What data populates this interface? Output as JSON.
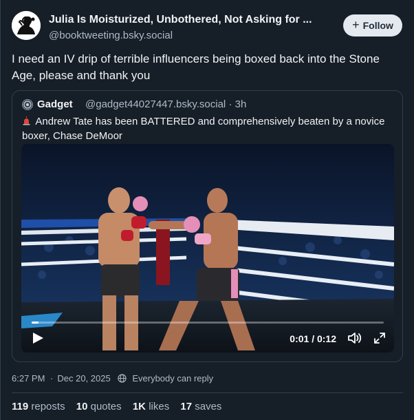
{
  "author": {
    "name": "Julia Is Moisturized, Unbothered, Not Asking for ...",
    "handle": "@booktweeting.bsky.social"
  },
  "follow_label": "Follow",
  "post_text": "I need an IV drip of terrible influencers being boxed back into the Stone Age, please and thank you",
  "quote": {
    "name": "Gadget",
    "handle": "@gadget44027447.bsky.social",
    "separator": "·",
    "age": "3h",
    "text": "Andrew Tate has been BATTERED and comprehensively beaten by a novice boxer, Chase DeMoor",
    "video": {
      "current_time": "0:01",
      "duration": "0:12",
      "time_display": "0:01 / 0:12",
      "progress_fraction": 0.02
    }
  },
  "timestamp": "6:27 PM",
  "date": "Dec 20, 2025",
  "reply_setting": "Everybody can reply",
  "stats": {
    "reposts_count": "119",
    "reposts_label": "reposts",
    "quotes_count": "10",
    "quotes_label": "quotes",
    "likes_count": "1K",
    "likes_label": "likes",
    "saves_count": "17",
    "saves_label": "saves"
  },
  "colors": {
    "background": "#161e27",
    "border": "#2e4052",
    "muted_text": "#aebbc9",
    "follow_button": "#e4e9ef"
  }
}
